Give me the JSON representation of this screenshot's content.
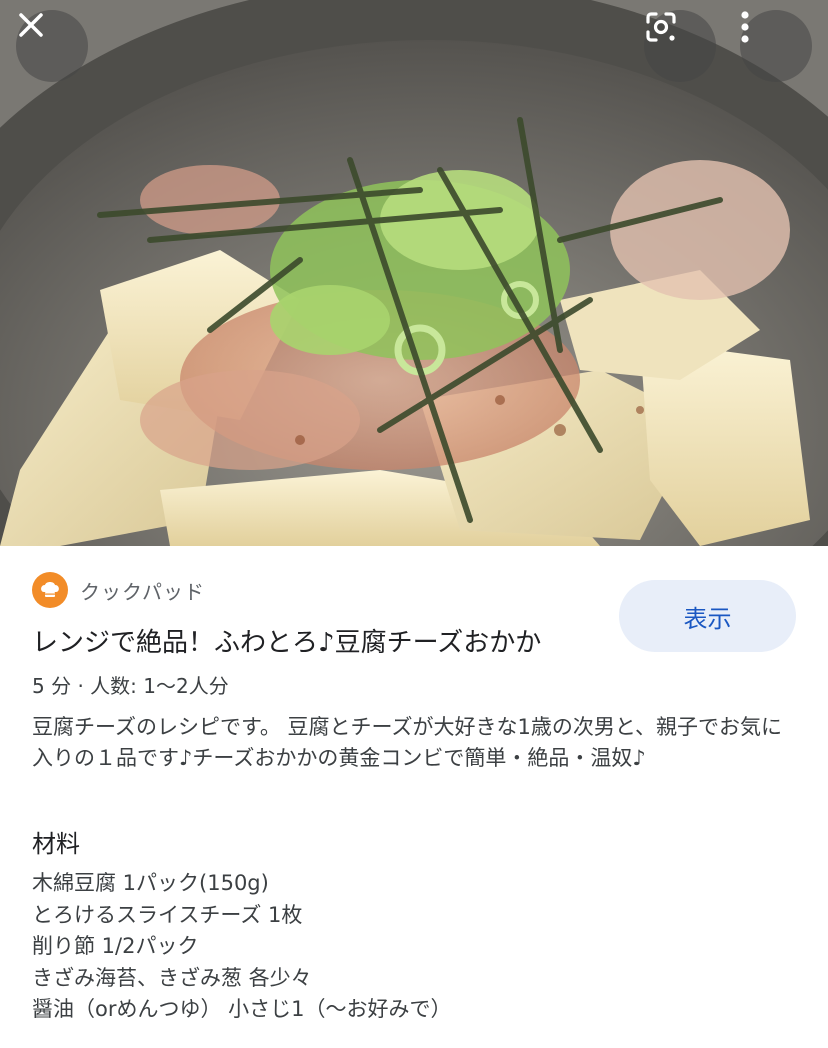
{
  "hero": {
    "image_alt": "豆腐チーズおかか"
  },
  "overlay": {
    "close_icon": "close-icon",
    "lens_icon": "lens-icon",
    "more_icon": "more-vert-icon"
  },
  "source": {
    "name": "クックパッド",
    "logo_icon": "chef-hat-icon",
    "logo_color": "#f28c28"
  },
  "view_button": {
    "label": "表示",
    "bg": "#e8eef9",
    "color": "#1a57c2"
  },
  "recipe": {
    "title": "レンジで絶品！ふわとろ♪豆腐チーズおかか",
    "meta": "5 分 · 人数: 1〜2人分",
    "description": "豆腐チーズのレシピです。 豆腐とチーズが大好きな1歳の次男と、親子でお気に入りの１品です♪チーズおかかの黄金コンビで簡単・絶品・温奴♪",
    "ingredients_heading": "材料",
    "ingredients": [
      "木綿豆腐 1パック(150g)",
      "とろけるスライスチーズ 1枚",
      "削り節 1/2パック",
      "きざみ海苔、きざみ葱 各少々",
      "醤油（orめんつゆ） 小さじ1（〜お好みで）"
    ]
  }
}
